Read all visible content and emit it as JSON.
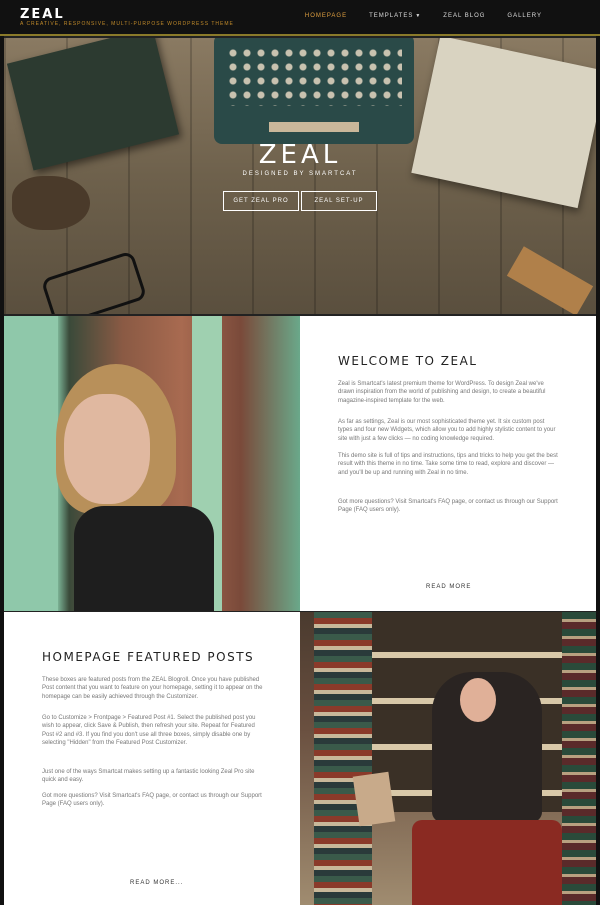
{
  "header": {
    "logo": "ZEAL",
    "tagline": "A Creative, Responsive, Multi-Purpose WordPress Theme",
    "nav": [
      {
        "label": "HOMEPAGE",
        "active": true
      },
      {
        "label": "TEMPLATES",
        "has_dropdown": true
      },
      {
        "label": "ZEAL BLOG"
      },
      {
        "label": "GALLERY"
      }
    ],
    "accent_color": "#e0a040"
  },
  "hero": {
    "title": "ZEAL",
    "subtitle": "DESIGNED BY SMARTCAT",
    "buttons": [
      "GET ZEAL PRO",
      "ZEAL SET-UP"
    ]
  },
  "welcome": {
    "title": "WELCOME TO ZEAL",
    "paragraphs": [
      "Zeal is Smartcat's latest premium theme for WordPress. To design Zeal we've drawn inspiration from the world of publishing and design, to create a beautiful magazine-inspired template for the web.",
      "As far as settings, Zeal is our most sophisticated theme yet. It six custom post types and four new Widgets, which allow you to add highly stylistic content to your site with just a few clicks — no coding knowledge required.",
      "This demo site is full of tips and instructions, tips and tricks to help you get the best result with this theme in no time. Take some time to read, explore and discover — and you'll be up and running with Zeal in no time.",
      "Got more questions? Visit Smartcat's FAQ page, or contact us through our Support Page (FAQ users only)."
    ],
    "read_more": "READ MORE"
  },
  "featured": {
    "title": "HOMEPAGE FEATURED POSTS",
    "paragraphs": [
      "These boxes are featured posts from the ZEAL Blogroll. Once you have published Post content that you want to feature on your homepage, setting it to appear on the homepage can be easily achieved through the Customizer.",
      "Go to Customize > Frontpage > Featured Post #1. Select the published post you wish to appear, click Save & Publish, then refresh your site. Repeat for Featured Post #2 and #3. If you find you don't use all three boxes, simply disable one by selecting \"Hidden\" from the Featured Post Customizer.",
      "Just one of the ways Smartcat makes setting up a fantastic looking Zeal Pro site quick and easy.",
      "Got more questions? Visit Smartcat's FAQ page, or contact us through our Support Page (FAQ users only)."
    ],
    "read_more": "READ MORE..."
  }
}
